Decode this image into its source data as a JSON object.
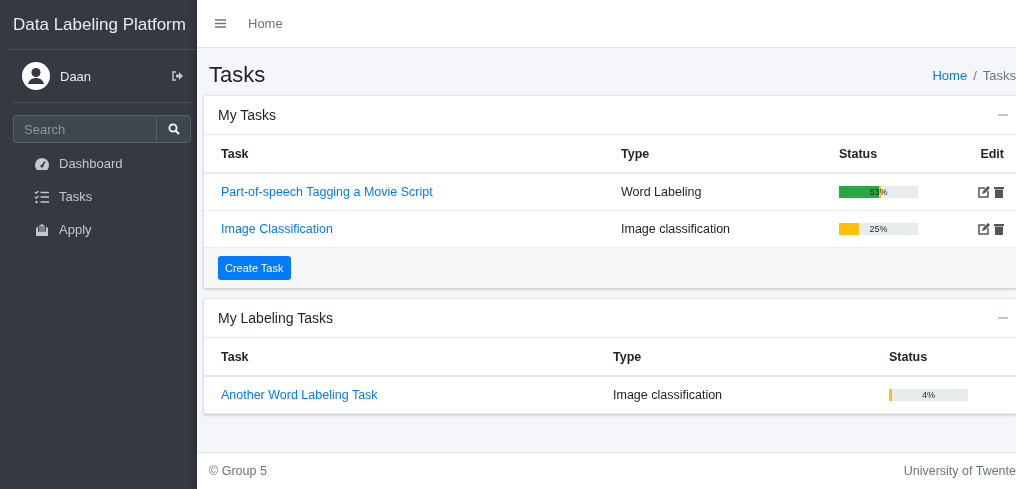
{
  "sidebar": {
    "brand": "Data Labeling Platform",
    "user": {
      "name": "Daan"
    },
    "search": {
      "placeholder": "Search"
    },
    "items": [
      {
        "label": "Dashboard",
        "kind": "gauge",
        "selected": false
      },
      {
        "label": "Tasks",
        "kind": "list",
        "selected": false
      },
      {
        "label": "Apply",
        "kind": "envelope",
        "selected": false
      }
    ]
  },
  "navbar": {
    "links": [
      "Home"
    ]
  },
  "page": {
    "title": "Tasks",
    "breadcrumb": [
      "Home",
      "Tasks"
    ],
    "breadcrumb_separator": "/"
  },
  "cards": [
    {
      "title": "My Tasks",
      "columns": [
        "Task",
        "Type",
        "Status",
        "Edit"
      ],
      "rows": [
        {
          "task": "Part-of-speech Tagging a Movie Script",
          "type": "Word Labeling",
          "reading": "53%",
          "segments": [
            {
              "color": "#28a745",
              "level": 0.5
            },
            {
              "color": "#ffc107",
              "level": 0.03
            }
          ]
        },
        {
          "task": "Image Classification",
          "type": "Image classification",
          "reading": "25%",
          "segments": [
            {
              "color": "#ffc107",
              "level": 0.25
            }
          ]
        }
      ],
      "footer_button": "Create Task"
    },
    {
      "title": "My Labeling Tasks",
      "columns": [
        "Task",
        "Type",
        "Status"
      ],
      "rows": [
        {
          "task": "Another Word Labeling Task",
          "type": "Image classification",
          "reading": "4%",
          "segments": [
            {
              "color": "#ffc107",
              "level": 0.04
            }
          ]
        }
      ]
    }
  ],
  "footer": {
    "left": "© Group 5",
    "right": "University of Twente"
  }
}
